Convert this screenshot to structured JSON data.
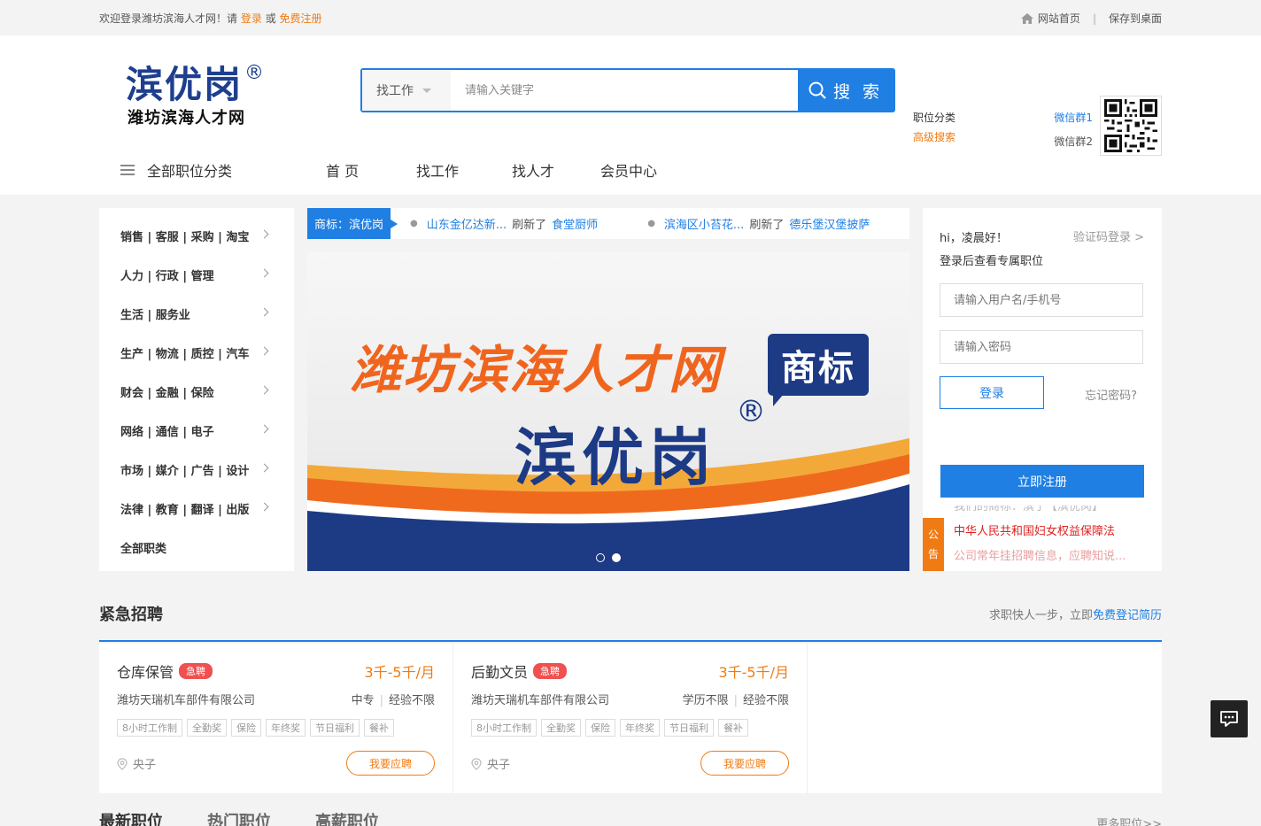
{
  "topbar": {
    "welcome_prefix": "欢迎登录潍坊滨海人才网！请",
    "login": "登录",
    "or": "或",
    "register": "免费注册",
    "home": "网站首页",
    "separator": "|",
    "save_desktop": "保存到桌面"
  },
  "logo": {
    "brand": "滨优岗",
    "registered": "®",
    "subtitle": "潍坊滨海人才网"
  },
  "search": {
    "type_label": "找工作",
    "placeholder": "请输入关键字",
    "button": "搜 索",
    "link_category": "职位分类",
    "link_advanced": "高级搜索"
  },
  "wechat": {
    "group1": "微信群1",
    "group2": "微信群2"
  },
  "nav": {
    "all_categories": "全部职位分类",
    "items": [
      "首 页",
      "找工作",
      "找人才",
      "会员中心"
    ]
  },
  "categories": [
    "销售 | 客服 | 采购 | 淘宝",
    "人力 | 行政 | 管理",
    "生活 | 服务业",
    "生产 | 物流 | 质控 | 汽车",
    "财会 | 金融 | 保险",
    "网络 | 通信 | 电子",
    "市场 | 媒介 | 广告 | 设计",
    "法律 | 教育 | 翻译 | 出版",
    "全部职类"
  ],
  "ticker": {
    "tag": "商标：滨优岗",
    "items": [
      {
        "company": "山东金亿达新...",
        "action": "刷新了",
        "job": "食堂厨师"
      },
      {
        "company": "滨海区小苔花...",
        "action": "刷新了",
        "job": "德乐堡汉堡披萨"
      }
    ]
  },
  "banner": {
    "headline": "潍坊滨海人才网",
    "badge": "商标",
    "brand": "滨优岗",
    "registered": "®"
  },
  "login": {
    "greeting": "hi，凌晨好！",
    "sms_login": "验证码登录 >",
    "subtitle": "登录后查看专属职位",
    "username_placeholder": "请输入用户名/手机号",
    "password_placeholder": "请输入密码",
    "login_button": "登录",
    "forgot": "忘记密码?",
    "register_button": "立即注册",
    "notice_tag_1": "公",
    "notice_tag_2": "告",
    "notices": [
      "我们的商标：滨于【滨优岗】",
      "中华人民共和国妇女权益保障法",
      "公司常年挂招聘信息，应聘知说..."
    ]
  },
  "urgent": {
    "title": "紧急招聘",
    "hint": "求职快人一步，立即",
    "hint_link": "免费登记简历",
    "jobs": [
      {
        "title": "仓库保管",
        "badge": "急聘",
        "salary": "3千-5千/月",
        "company": "潍坊天瑞机车部件有限公司",
        "education": "中专",
        "experience": "经验不限",
        "welfare": [
          "8小时工作制",
          "全勤奖",
          "保险",
          "年终奖",
          "节日福利",
          "餐补"
        ],
        "location": "央子",
        "apply": "我要应聘"
      },
      {
        "title": "后勤文员",
        "badge": "急聘",
        "salary": "3千-5千/月",
        "company": "潍坊天瑞机车部件有限公司",
        "education": "学历不限",
        "experience": "经验不限",
        "welfare": [
          "8小时工作制",
          "全勤奖",
          "保险",
          "年终奖",
          "节日福利",
          "餐补"
        ],
        "location": "央子",
        "apply": "我要应聘"
      }
    ]
  },
  "bottom_tabs": {
    "tabs": [
      "最新职位",
      "热门职位",
      "高薪职位"
    ],
    "more": "更多职位>>"
  },
  "colors": {
    "primary": "#1f7fe3",
    "accent": "#f07b14",
    "brand_navy": "#1d3a85"
  }
}
